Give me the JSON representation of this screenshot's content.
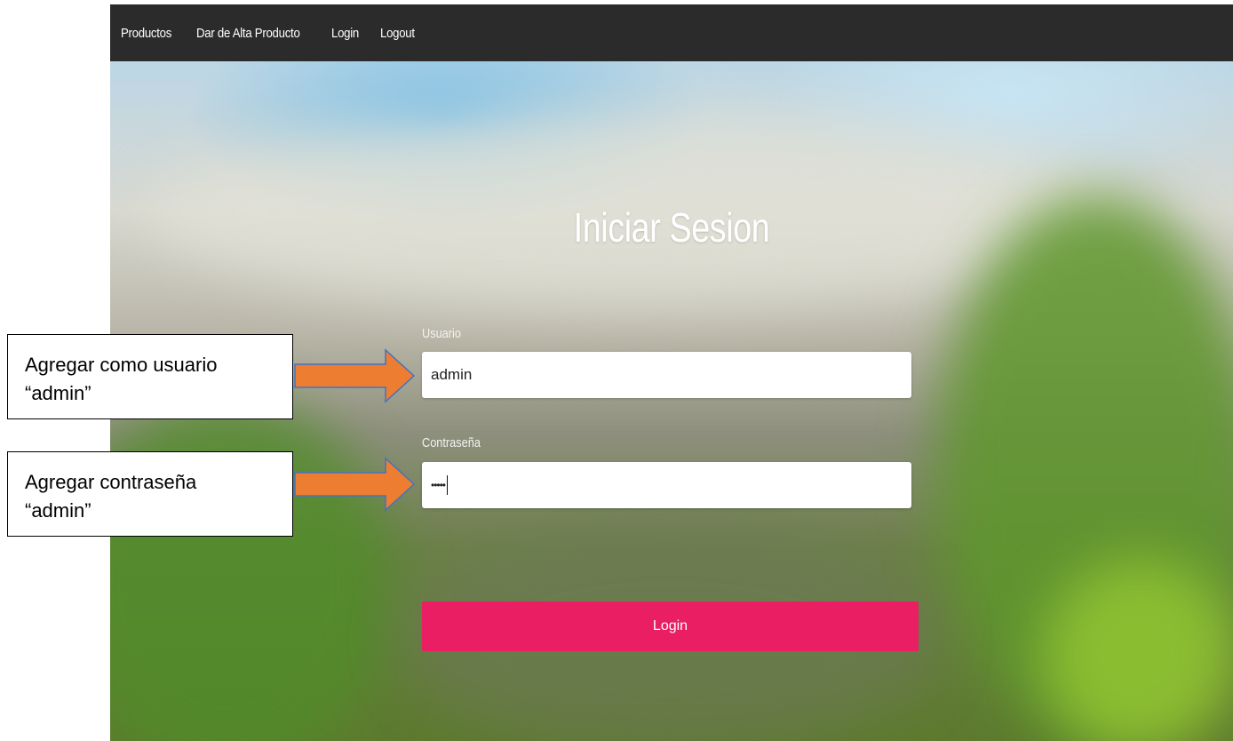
{
  "nav": {
    "items": [
      {
        "label": "Productos"
      },
      {
        "label": "Dar de Alta Producto"
      },
      {
        "label": "Login"
      },
      {
        "label": "Logout"
      }
    ]
  },
  "login_form": {
    "title": "Iniciar Sesion",
    "username_label": "Usuario",
    "username_value": "admin",
    "password_label": "Contraseña",
    "password_value": "•••••",
    "submit_label": "Login"
  },
  "annotations": {
    "user_callout_line1": "Agregar como usuario",
    "user_callout_line2": "“admin”",
    "pass_callout_line1": "Agregar contraseña",
    "pass_callout_line2": "“admin”"
  },
  "colors": {
    "navbar": "#2b2b2b",
    "login_button": "#e91e63",
    "arrow_fill": "#ed7d31",
    "arrow_stroke": "#4472c4"
  }
}
